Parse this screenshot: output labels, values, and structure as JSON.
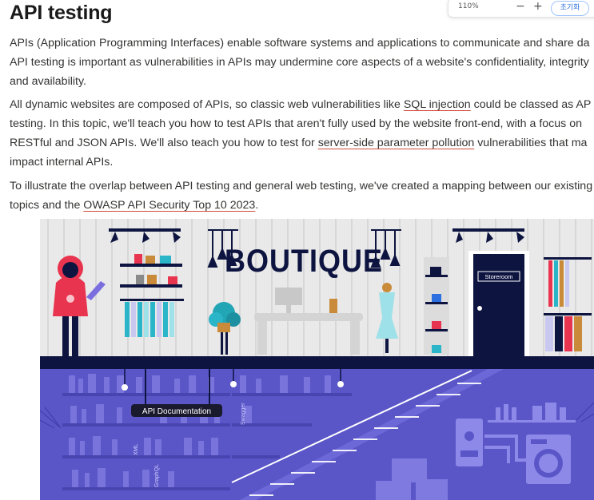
{
  "page": {
    "title": "API testing"
  },
  "zoom": {
    "value": "110%",
    "minus": "−",
    "plus": "+",
    "reset": "초기화"
  },
  "paragraphs": {
    "p1": {
      "line1": "APIs (Application Programming Interfaces) enable software systems and applications to communicate and share da",
      "line2": "API testing is important as vulnerabilities in APIs may undermine core aspects of a website's confidentiality, integrity",
      "line3": "and availability."
    },
    "p2": {
      "line1_a": "All dynamic websites are composed of APIs, so classic web vulnerabilities like ",
      "line1_link": "SQL injection",
      "line1_b": " could be classed as AP",
      "line2": "testing. In this topic, we'll teach you how to test APIs that aren't fully used by the website front-end, with a focus on",
      "line3_a": "RESTful and JSON APIs. We'll also teach you how to test for ",
      "line3_link": "server-side parameter pollution",
      "line3_b": " vulnerabilities that ma",
      "line4": "impact internal APIs."
    },
    "p3": {
      "line1": "To illustrate the overlap between API testing and general web testing, we've created a mapping between our existing",
      "line2_a": "topics and the ",
      "line2_link": "OWASP API Security Top 10 2023",
      "line2_b": "."
    }
  },
  "illustration": {
    "shop_sign": "BOUTIQUE",
    "storeroom_sign": "Storeroom",
    "api_doc_label": "API Documentation",
    "book_labels": {
      "swagger": "Swagger",
      "xml": "XML",
      "graphql": "GraphQL"
    },
    "colors": {
      "wall": "#e9e9e9",
      "floor": "#0d1440",
      "basement": "#5a56c8",
      "basement_dark": "#4844b0",
      "accent_red": "#e8344e",
      "door": "#0d1440"
    }
  }
}
